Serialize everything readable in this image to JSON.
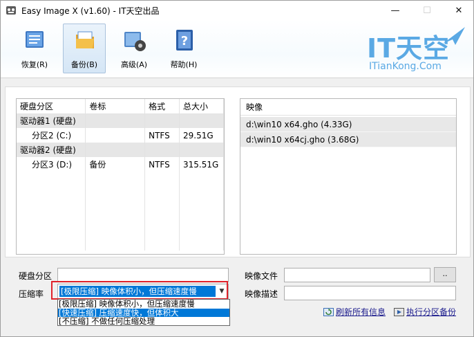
{
  "window": {
    "title": "Easy Image X (v1.60) - IT天空出品",
    "min_glyph": "—",
    "max_glyph": "☐",
    "close_glyph": "✕"
  },
  "toolbar": {
    "buttons": [
      {
        "label": "恢复(R)",
        "icon": "restore-icon"
      },
      {
        "label": "备份(B)",
        "icon": "backup-icon",
        "active": true
      },
      {
        "label": "高级(A)",
        "icon": "advanced-icon"
      },
      {
        "label": "帮助(H)",
        "icon": "help-icon"
      }
    ]
  },
  "logo": {
    "main": "IT天空",
    "sub": "ITianKong.Com",
    "color": "#5aa9e4"
  },
  "partitions": {
    "headers": [
      "硬盘分区",
      "卷标",
      "格式",
      "总大小"
    ],
    "rows": [
      {
        "type": "group",
        "cells": [
          "驱动器1 (硬盘)",
          "",
          "",
          ""
        ]
      },
      {
        "type": "item",
        "cells": [
          "分区2 (C:)",
          "",
          "NTFS",
          "29.51G"
        ]
      },
      {
        "type": "group",
        "cells": [
          "驱动器2 (硬盘)",
          "",
          "",
          ""
        ]
      },
      {
        "type": "item",
        "cells": [
          "分区3 (D:)",
          "备份",
          "NTFS",
          "315.51G"
        ]
      }
    ]
  },
  "images": {
    "header": "映像",
    "items": [
      "d:\\win10 x64.gho (4.33G)",
      "d:\\win10 x64cj.gho (3.68G)"
    ]
  },
  "form": {
    "partition_label": "硬盘分区",
    "partition_value": "",
    "compression_label": "压缩率",
    "compression_selected": "[极限压缩] 映像体积小，但压缩速度慢",
    "compression_options": [
      "[极限压缩] 映像体积小，但压缩速度慢",
      "[快速压缩] 压缩速度快，但体积大",
      "[不压缩] 不做任何压缩处理"
    ],
    "compression_highlighted_index": 1,
    "image_file_label": "映像文件",
    "image_file_value": "",
    "browse_label": "..",
    "image_desc_label": "映像描述",
    "image_desc_value": "",
    "refresh_label": "刷新所有信息",
    "run_label": "执行分区备份"
  },
  "colors": {
    "selection": "#0078d7",
    "focus_outline": "#e0232b",
    "group_row": "#e6e6e6"
  }
}
